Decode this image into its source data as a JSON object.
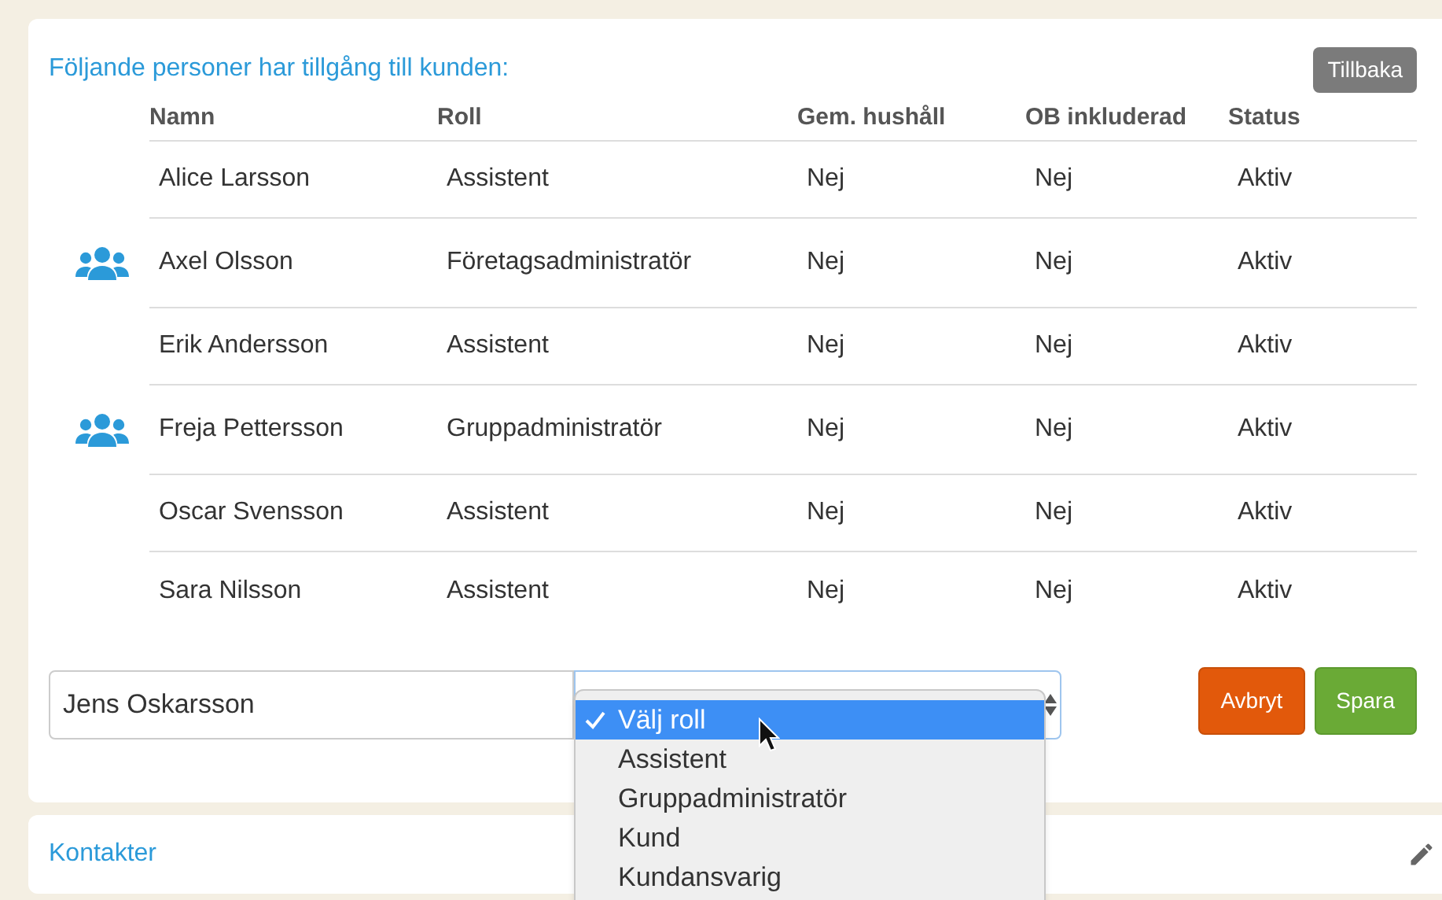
{
  "panel": {
    "title": "Följande personer har tillgång till kunden:",
    "back_button": "Tillbaka"
  },
  "table": {
    "columns": [
      "Namn",
      "Roll",
      "Gem. hushåll",
      "OB inkluderad",
      "Status"
    ],
    "rows": [
      {
        "group_icon": false,
        "cells": [
          "Alice Larsson",
          "Assistent",
          "Nej",
          "Nej",
          "Aktiv"
        ]
      },
      {
        "group_icon": true,
        "cells": [
          "Axel Olsson",
          "Företagsadministratör",
          "Nej",
          "Nej",
          "Aktiv"
        ]
      },
      {
        "group_icon": false,
        "cells": [
          "Erik Andersson",
          "Assistent",
          "Nej",
          "Nej",
          "Aktiv"
        ]
      },
      {
        "group_icon": true,
        "cells": [
          "Freja Pettersson",
          "Gruppadministratör",
          "Nej",
          "Nej",
          "Aktiv"
        ]
      },
      {
        "group_icon": false,
        "cells": [
          "Oscar Svensson",
          "Assistent",
          "Nej",
          "Nej",
          "Aktiv"
        ]
      },
      {
        "group_icon": false,
        "cells": [
          "Sara Nilsson",
          "Assistent",
          "Nej",
          "Nej",
          "Aktiv"
        ]
      }
    ]
  },
  "new_person": {
    "name_value": "Jens Oskarsson",
    "role_options": [
      {
        "label": "Välj roll",
        "selected": true
      },
      {
        "label": "Assistent",
        "selected": false
      },
      {
        "label": "Gruppadministratör",
        "selected": false
      },
      {
        "label": "Kund",
        "selected": false
      },
      {
        "label": "Kundansvarig",
        "selected": false
      }
    ],
    "cancel_button": "Avbryt",
    "save_button": "Spara"
  },
  "contacts": {
    "title": "Kontakter"
  }
}
